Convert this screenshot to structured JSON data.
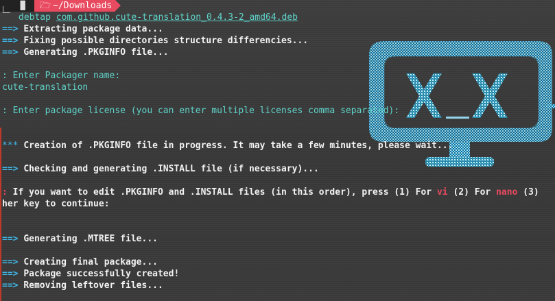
{
  "prompt": {
    "path": "~/Downloads",
    "command": "debtap",
    "argument": "com.github.cute-translation_0.4.3-2_amd64.deb"
  },
  "output": {
    "l1": "Extracting package data...",
    "l2": "Fixing possible directories structure differencies...",
    "l3": "Generating .PKGINFO file...",
    "packager_prompt": ": Enter Packager name:",
    "packager_value": "cute-translation",
    "license_prompt": ": Enter package license (you can enter multiple licenses comma separated):",
    "creation": "Creation of .PKGINFO file in progress. It may take a few minutes, please wait...",
    "checking": "Checking and generating .INSTALL file (if necessary)...",
    "edit_prefix": "If you want to edit .PKGINFO and .INSTALL files (in this order), press (1) For",
    "edit_vi": "vi",
    "edit_mid": "(2) For",
    "edit_nano": "nano",
    "edit_tail": "(3)",
    "edit_cont": "her key to continue:",
    "mtree": "Generating .MTREE file...",
    "final": "Creating final package...",
    "success": "Package successfully created!",
    "removing": "Removing leftover files..."
  },
  "markers": {
    "arrow": "==>",
    "colon": ":",
    "stars": "***"
  },
  "colors": {
    "accent": "#e84a5f",
    "arrow": "#3fb6e6",
    "teal": "#5fd3c9",
    "background": "#3a3a3a"
  }
}
